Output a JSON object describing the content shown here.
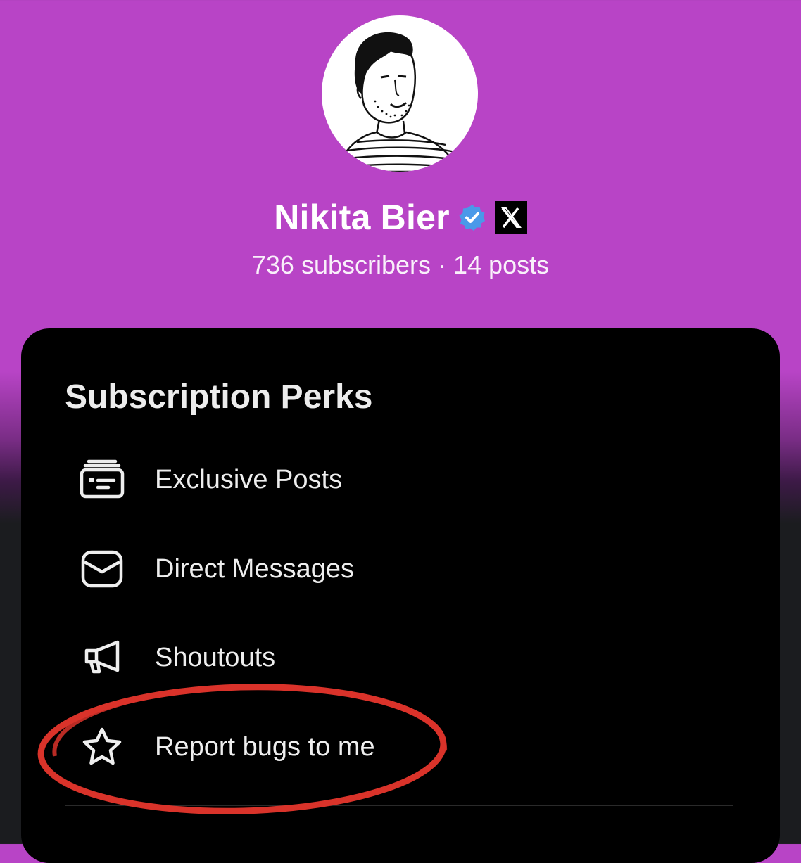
{
  "profile": {
    "name": "Nikita Bier",
    "stats": "736 subscribers · 14 posts",
    "verified_color": "#4a99e9",
    "background_color": "#b844c6"
  },
  "perks": {
    "title": "Subscription Perks",
    "items": [
      {
        "label": "Exclusive Posts",
        "icon": "exclusive-posts-icon"
      },
      {
        "label": "Direct Messages",
        "icon": "envelope-icon"
      },
      {
        "label": "Shoutouts",
        "icon": "megaphone-icon"
      },
      {
        "label": "Report bugs to me",
        "icon": "star-icon"
      }
    ]
  },
  "annotation": {
    "color": "#d9332a",
    "target": "Report bugs to me"
  }
}
